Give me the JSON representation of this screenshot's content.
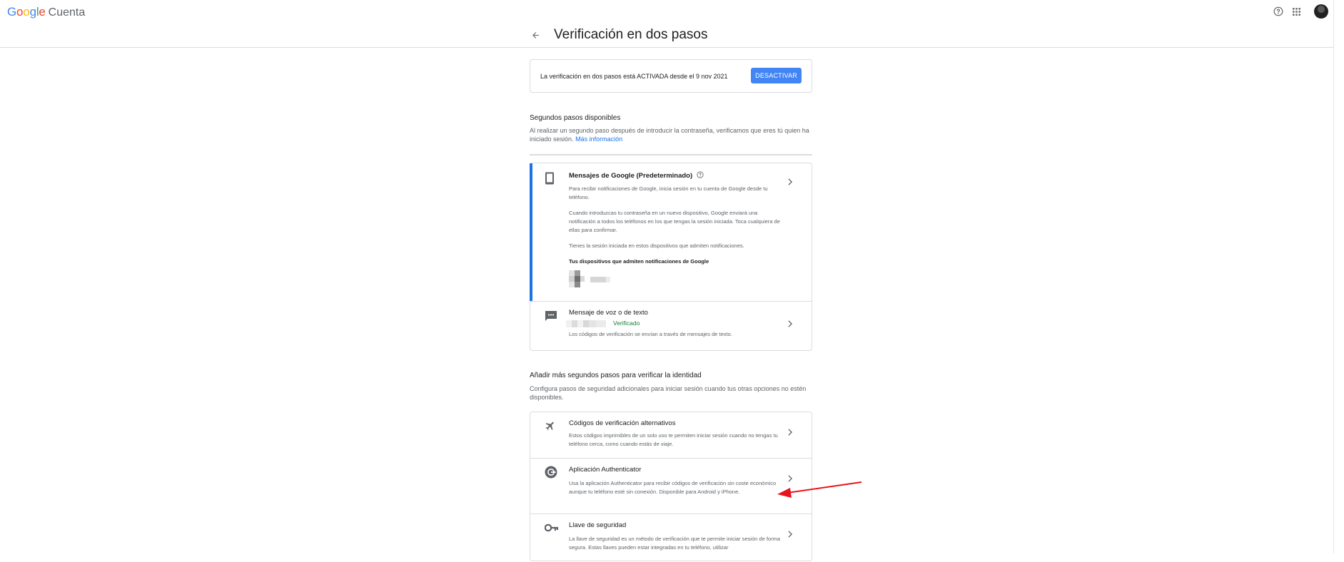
{
  "header": {
    "logo_letters": [
      "G",
      "o",
      "o",
      "g",
      "l",
      "e"
    ],
    "logo_colors": [
      "#4285f4",
      "#ea4335",
      "#fbbc05",
      "#4285f4",
      "#34a853",
      "#ea4335"
    ],
    "product": "Cuenta",
    "icons": [
      "help-icon",
      "apps-icon",
      "avatar"
    ]
  },
  "page": {
    "title": "Verificación en dos pasos",
    "back_icon": "arrow-back-icon"
  },
  "status": {
    "text": "La verificación en dos pasos está ACTIVADA desde el 9 nov 2021",
    "button": "DESACTIVAR"
  },
  "available": {
    "heading": "Segundos pasos disponibles",
    "desc": "Al realizar un segundo paso después de introducir la contraseña, verificamos que eres tú quien ha iniciado sesión.",
    "link": "Más información",
    "items": [
      {
        "icon": "smartphone-icon",
        "title": "Mensajes de Google (Predeterminado)",
        "desc1": "Para recibir notificaciones de Google, inicia sesión en tu cuenta de Google desde tu teléfono.",
        "desc2": "Cuando introduzcas tu contraseña en un nuevo dispositivo, Google enviará una notificación a todos los teléfonos en los que tengas la sesión iniciada. Toca cualquiera de ellas para confirmar.",
        "desc3": "Tienes la sesión iniciada en estos dispositivos que admiten notificaciones.",
        "devices_label": "Tus dispositivos que admiten notificaciones de Google"
      },
      {
        "icon": "sms-icon",
        "title": "Mensaje de voz o de texto",
        "status": "Verificado",
        "desc": "Los códigos de verificación se envían a través de mensajes de texto."
      }
    ]
  },
  "more": {
    "heading": "Añadir más segundos pasos para verificar la identidad",
    "desc": "Configura pasos de seguridad adicionales para iniciar sesión cuando tus otras opciones no estén disponibles.",
    "items": [
      {
        "icon": "airplane-icon",
        "title": "Códigos de verificación alternativos",
        "desc": "Estos códigos imprimibles de un solo uso te permiten iniciar sesión cuando no tengas tu teléfono cerca, como cuando estás de viaje."
      },
      {
        "icon": "authenticator-icon",
        "title": "Aplicación Authenticator",
        "desc": "Usa la aplicación Authenticator para recibir códigos de verificación sin coste económico aunque tu teléfono esté sin conexión. Disponible para Android y iPhone."
      },
      {
        "icon": "key-icon",
        "title": "Llave de seguridad",
        "desc": "La llave de seguridad es un método de verificación que te permite iniciar sesión de forma segura. Estas llaves pueden estar integradas en tu teléfono, utilizar"
      }
    ]
  },
  "annotation": {
    "arrow_color": "#e8141b"
  }
}
